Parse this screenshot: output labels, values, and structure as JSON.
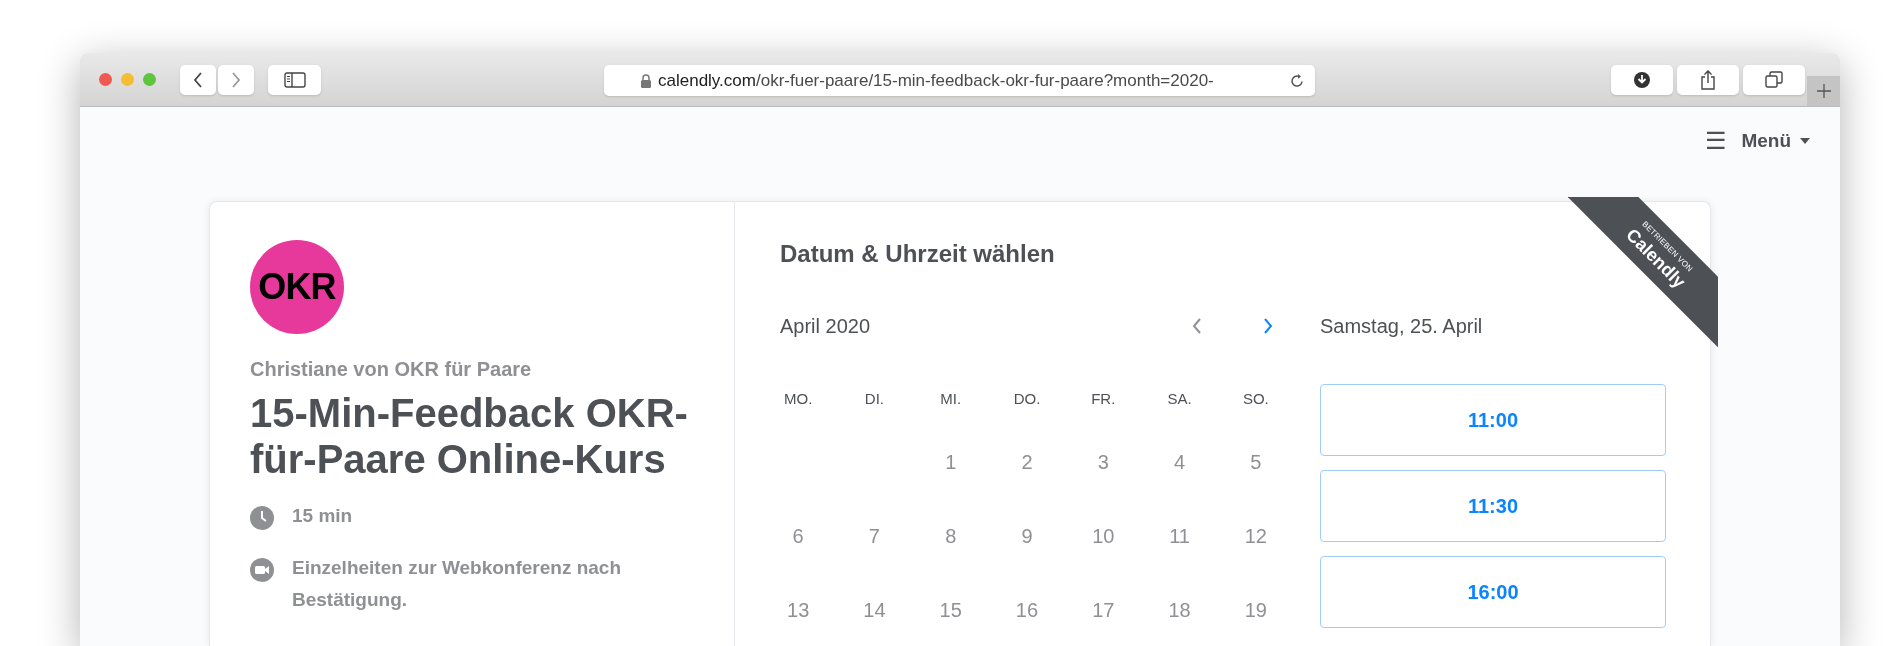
{
  "browser": {
    "url_host": "calendly.com",
    "url_path": "/okr-fuer-paare/15-min-feedback-okr-fur-paare?month=2020-"
  },
  "header": {
    "menu_icon": "☰",
    "menu_label": "Menü"
  },
  "event": {
    "logo_text": "OKR",
    "organizer": "Christiane von OKR für Paare",
    "title": "15-Min-Feedback OKR-für-Paare Online-Kurs",
    "details": [
      {
        "kind": "duration",
        "text": "15 min"
      },
      {
        "kind": "video",
        "text": "Einzelheiten zur Webkonferenz nach Bestätigung."
      }
    ]
  },
  "scheduler": {
    "heading": "Datum & Uhrzeit wählen",
    "month": "April 2020",
    "selected_day": "Samstag, 25. April",
    "prev_enabled": false,
    "next_enabled": true,
    "weekdays": [
      "MO.",
      "DI.",
      "MI.",
      "DO.",
      "FR.",
      "SA.",
      "SO."
    ],
    "weeks": [
      {
        "kind": "partial",
        "days": [
          "1",
          "2",
          "3",
          "4",
          "5"
        ]
      },
      {
        "kind": "full",
        "days": [
          "6",
          "7",
          "8",
          "9",
          "10",
          "11",
          "12"
        ]
      },
      {
        "kind": "full",
        "days": [
          "13",
          "14",
          "15",
          "16",
          "17",
          "18",
          "19"
        ]
      }
    ],
    "times": [
      "11:00",
      "11:30",
      "16:00"
    ]
  },
  "ribbon": {
    "small": "BETRIEBEN VON",
    "brand": "Calendly"
  }
}
